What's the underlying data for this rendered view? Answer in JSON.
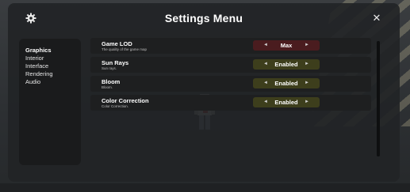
{
  "window": {
    "title": "Settings Menu",
    "close_symbol": "✕",
    "icons": [
      "gear-icon",
      "close-icon"
    ]
  },
  "sidebar": {
    "items": [
      {
        "label": "Graphics",
        "active": true
      },
      {
        "label": "Interior",
        "active": false
      },
      {
        "label": "Interface",
        "active": false
      },
      {
        "label": "Rendering",
        "active": false
      },
      {
        "label": "Audio",
        "active": false
      }
    ]
  },
  "settings": [
    {
      "title": "Game LOD",
      "description": "The quality of the game map",
      "value": "Max",
      "color": "#4a1c1f"
    },
    {
      "title": "Sun Rays",
      "description": "Sun rays.",
      "value": "Enabled",
      "color": "#3d3e1c"
    },
    {
      "title": "Bloom",
      "description": "Bloom.",
      "value": "Enabled",
      "color": "#3d3e1c"
    },
    {
      "title": "Color Correction",
      "description": "Color Correction.",
      "value": "Enabled",
      "color": "#3d3e1c"
    }
  ],
  "selector_arrows": {
    "left": "◄",
    "right": "►"
  },
  "colors": {
    "panel": "#222426",
    "sidebar": "#1a1b1c",
    "row": "#1e1f20",
    "value_max": "#4a1c1f",
    "value_enabled": "#3d3e1c"
  }
}
